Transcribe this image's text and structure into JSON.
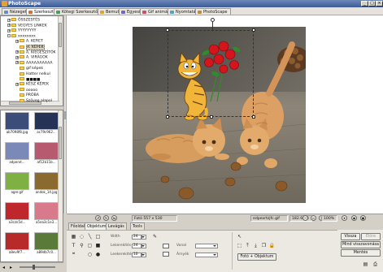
{
  "window": {
    "title": "PhotoScape",
    "min": "_",
    "max": "□",
    "close": "×"
  },
  "tabs": [
    {
      "label": "Nézegető",
      "color": "#5a8ed6"
    },
    {
      "label": "Szerkesztő",
      "color": "#e06a2a",
      "active": true
    },
    {
      "label": "Kötegi Szerkesztő",
      "color": "#3fa05a"
    },
    {
      "label": "Bemutató",
      "color": "#d9a629"
    },
    {
      "label": "Egyesítés",
      "color": "#7a5fd1"
    },
    {
      "label": "Gif animáció",
      "color": "#d24a7a"
    },
    {
      "label": "Nyomtatás",
      "color": "#4aa3c9"
    },
    {
      "label": "PhotoScape",
      "color": "#c48b2d"
    }
  ],
  "tree": [
    {
      "label": "ÖSSZESTÉS",
      "expander": "+",
      "depth": 1
    },
    {
      "label": "VEGYES LINKEK",
      "expander": "+",
      "depth": 1
    },
    {
      "label": "YYYYYYYY",
      "expander": "+",
      "depth": 1
    },
    {
      "label": "xxxxxxxx",
      "expander": "-",
      "depth": 1
    },
    {
      "label": "A. KERET",
      "expander": "+",
      "depth": 2
    },
    {
      "label": "A. KÉPEK",
      "expander": "",
      "depth": 2,
      "selected": true
    },
    {
      "label": "A. KIEGÉSZÍTŐK",
      "expander": "+",
      "depth": 2
    },
    {
      "label": "A. VIRÁGOK",
      "expander": "+",
      "depth": 2
    },
    {
      "label": "AAAAAAAAAA",
      "expander": "+",
      "depth": 2
    },
    {
      "label": "gif képek",
      "expander": "",
      "depth": 2
    },
    {
      "label": "Hatter nelkul",
      "expander": "",
      "depth": 2
    },
    {
      "label": "■■■■",
      "expander": "",
      "depth": 2
    },
    {
      "label": "KÉSZ KÉPEK",
      "expander": "+",
      "depth": 2
    },
    {
      "label": "ooooo",
      "expander": "",
      "depth": 2
    },
    {
      "label": "PRÓBA",
      "expander": "",
      "depth": 2
    },
    {
      "label": "Szöveg alapol",
      "expander": "",
      "depth": 2
    }
  ],
  "thumbnails": [
    {
      "name": "ab7098f8.jpg",
      "bg": "#3d4d7a"
    },
    {
      "name": "ac79c962...",
      "bg": "#243356"
    },
    {
      "name": "adperxt...",
      "bg": "#7a89b8"
    },
    {
      "name": "af12b11b...",
      "bg": "#b85a6f"
    },
    {
      "name": "ager.gif",
      "bg": "#7eb043"
    },
    {
      "name": "andok_14.jpg",
      "bg": "#8a6a2f"
    },
    {
      "name": "a3czn5d...",
      "bg": "#c0272d"
    },
    {
      "name": "a5ea3c1e3...",
      "bg": "#d97a8c"
    },
    {
      "name": "a8ev9f7...",
      "bg": "#b82a2a"
    },
    {
      "name": "a89db7c0...",
      "bg": "#5a7a3a"
    }
  ],
  "status": {
    "size": "Fotó 557 x 530",
    "filename": "edpexrtzjfc.gif",
    "filesize": "182.6 KB",
    "zoom": "100%"
  },
  "bottom_tabs": [
    "Főoldal",
    "Objektum",
    "Levágás",
    "Tools"
  ],
  "object_panel": {
    "width_label": "Wdth",
    "width_value": "24",
    "height_label": "Lekerekítés",
    "height_value": "24",
    "thick_label": "Leekerekítés",
    "thick_value": "10",
    "line_label": "Vonal",
    "shadow_label": "Árnyék",
    "photo_object_btn": "Fotó + Objektum"
  },
  "right_buttons": {
    "undo": "Vissza",
    "redo": "Előre",
    "undo_all": "Mind visszavonása",
    "save": "Mentés"
  }
}
